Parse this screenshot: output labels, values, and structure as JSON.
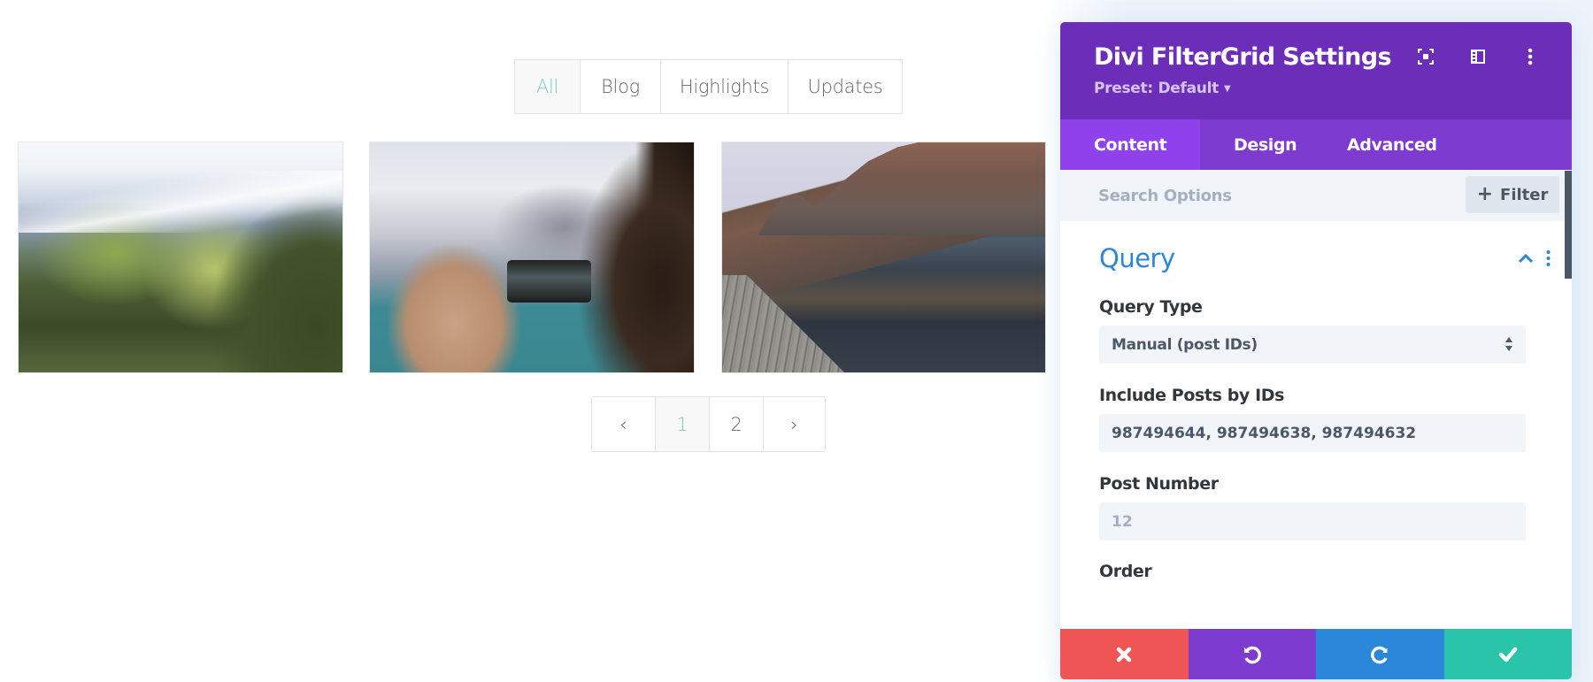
{
  "page": {
    "filters": [
      {
        "label": "All",
        "active": true
      },
      {
        "label": "Blog",
        "active": false
      },
      {
        "label": "Highlights",
        "active": false
      },
      {
        "label": "Updates",
        "active": false
      }
    ],
    "grid_items": [
      {
        "image": "mountain-valley-photo"
      },
      {
        "image": "phone-photography-photo"
      },
      {
        "image": "lake-dock-photo"
      }
    ],
    "pagination": {
      "prev_icon": "chevron-left-icon",
      "pages": [
        "1",
        "2"
      ],
      "current": "1",
      "next_icon": "chevron-right-icon",
      "prev_glyph": "‹",
      "next_glyph": "›"
    },
    "colors": {
      "filter_active": "#7fc6cf"
    }
  },
  "modal": {
    "title": "Divi FilterGrid Settings",
    "preset": "Preset: Default",
    "header_icons": [
      "focus-mode-icon",
      "split-view-icon",
      "more-options-icon"
    ],
    "tabs": [
      {
        "label": "Content",
        "active": true
      },
      {
        "label": "Design",
        "active": false
      },
      {
        "label": "Advanced",
        "active": false
      }
    ],
    "search": {
      "placeholder": "Search Options",
      "value": ""
    },
    "filter_button": {
      "icon": "+",
      "label": "Filter"
    },
    "group": {
      "title": "Query",
      "expanded": true
    },
    "fields": {
      "query_type": {
        "label": "Query Type",
        "value": "Manual (post IDs)"
      },
      "include_posts": {
        "label": "Include Posts by IDs",
        "value": "987494644, 987494638, 987494632"
      },
      "post_number": {
        "label": "Post Number",
        "placeholder": "12",
        "value": ""
      },
      "order": {
        "label": "Order"
      }
    },
    "footer": [
      "discard-icon",
      "undo-icon",
      "redo-icon",
      "save-icon"
    ],
    "colors": {
      "header": "#6c2eb9",
      "tabs": "#7d3bcf",
      "tab_active": "#8f42ec",
      "accent_blue": "#2b87da",
      "discard": "#ef5555",
      "undo": "#7e3bd0",
      "redo": "#2b87da",
      "save": "#29c4a9"
    }
  }
}
